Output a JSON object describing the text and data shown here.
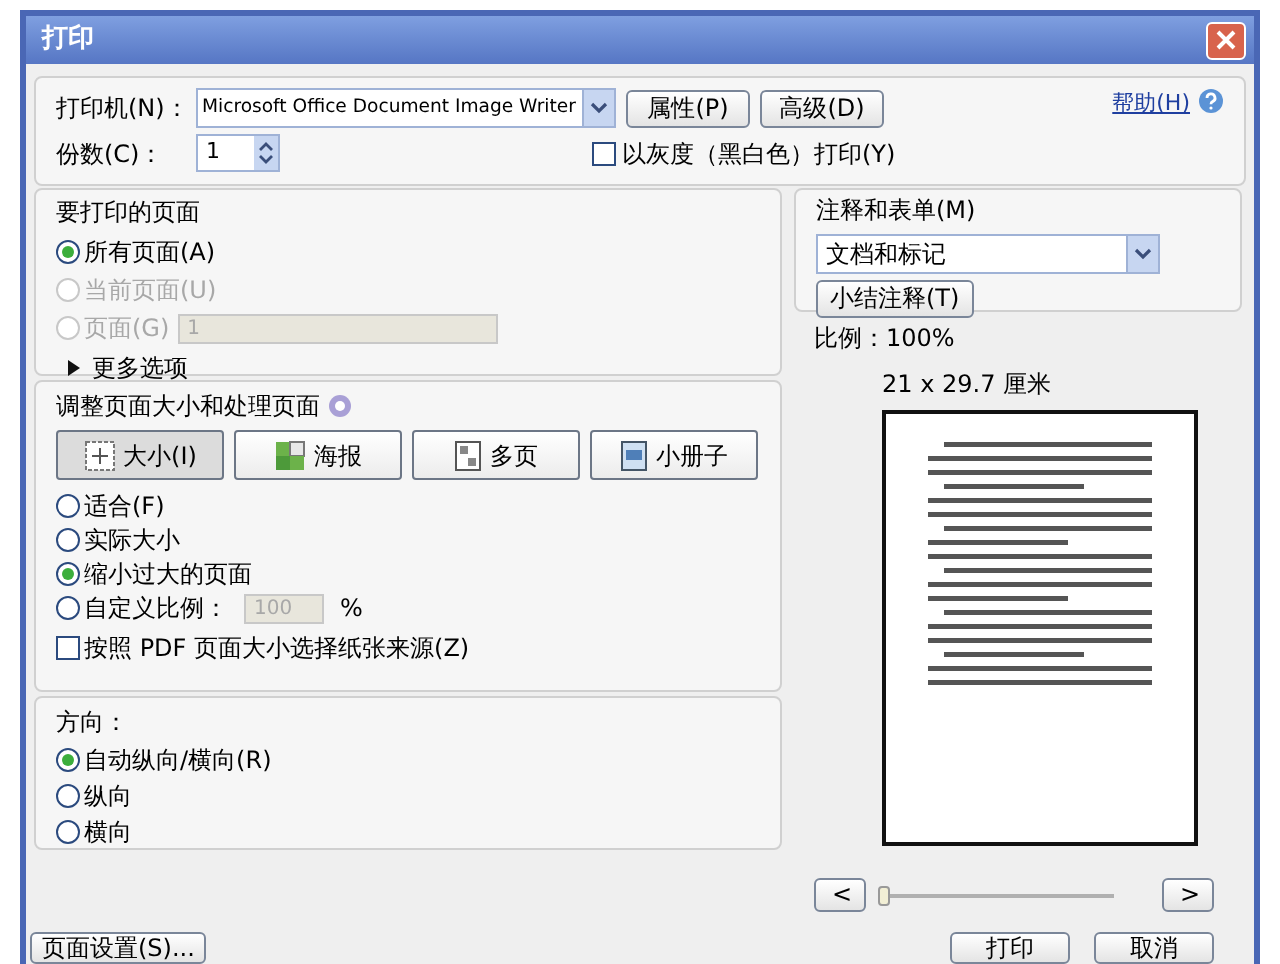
{
  "window": {
    "title": "打印"
  },
  "printer": {
    "label": "打印机(N)：",
    "value": "Microsoft Office Document Image Writer",
    "buttons": [
      "属性(P)",
      "高级(D)"
    ],
    "help": "帮助(H)"
  },
  "copies": {
    "label": "份数(C)：",
    "value": "1"
  },
  "grayscale": {
    "label": "以灰度（黑白色）打印(Y)",
    "checked": false
  },
  "pages_to_print": {
    "title": "要打印的页面",
    "options": [
      {
        "label": "所有页面(A)",
        "selected": true,
        "disabled": false
      },
      {
        "label": "当前页面(U)",
        "selected": false,
        "disabled": true
      },
      {
        "label": "页面(G)",
        "selected": false,
        "disabled": true,
        "value": "1"
      }
    ],
    "more": "更多选项"
  },
  "page_handling": {
    "title": "调整页面大小和处理页面",
    "modes": [
      {
        "kind": "size",
        "label": "大小(I)",
        "selected": true
      },
      {
        "kind": "poster",
        "label": "海报",
        "selected": false
      },
      {
        "kind": "multiple",
        "label": "多页",
        "selected": false
      },
      {
        "kind": "booklet",
        "label": "小册子",
        "selected": false
      }
    ],
    "options": [
      {
        "label": "适合(F)",
        "selected": false
      },
      {
        "label": "实际大小",
        "selected": false
      },
      {
        "label": "缩小过大的页面",
        "selected": true
      },
      {
        "label": "自定义比例：",
        "selected": false,
        "value": "100",
        "unit": "%"
      }
    ],
    "pdf_paper": {
      "label": "按照 PDF 页面大小选择纸张来源(Z)",
      "checked": false
    }
  },
  "orientation": {
    "title": "方向：",
    "options": [
      {
        "label": "自动纵向/横向(R)",
        "selected": true
      },
      {
        "label": "纵向",
        "selected": false
      },
      {
        "label": "横向",
        "selected": false
      }
    ]
  },
  "annotations": {
    "title": "注释和表单(M)",
    "value": "文档和标记",
    "summarize": "小结注释(T)"
  },
  "preview": {
    "scale": "比例：100%",
    "size": "21 x 29.7 厘米",
    "prev": "<",
    "next": ">",
    "level": 0
  },
  "buttons": {
    "page_setup": "页面设置(S)...",
    "print": "打印",
    "cancel": "取消"
  }
}
